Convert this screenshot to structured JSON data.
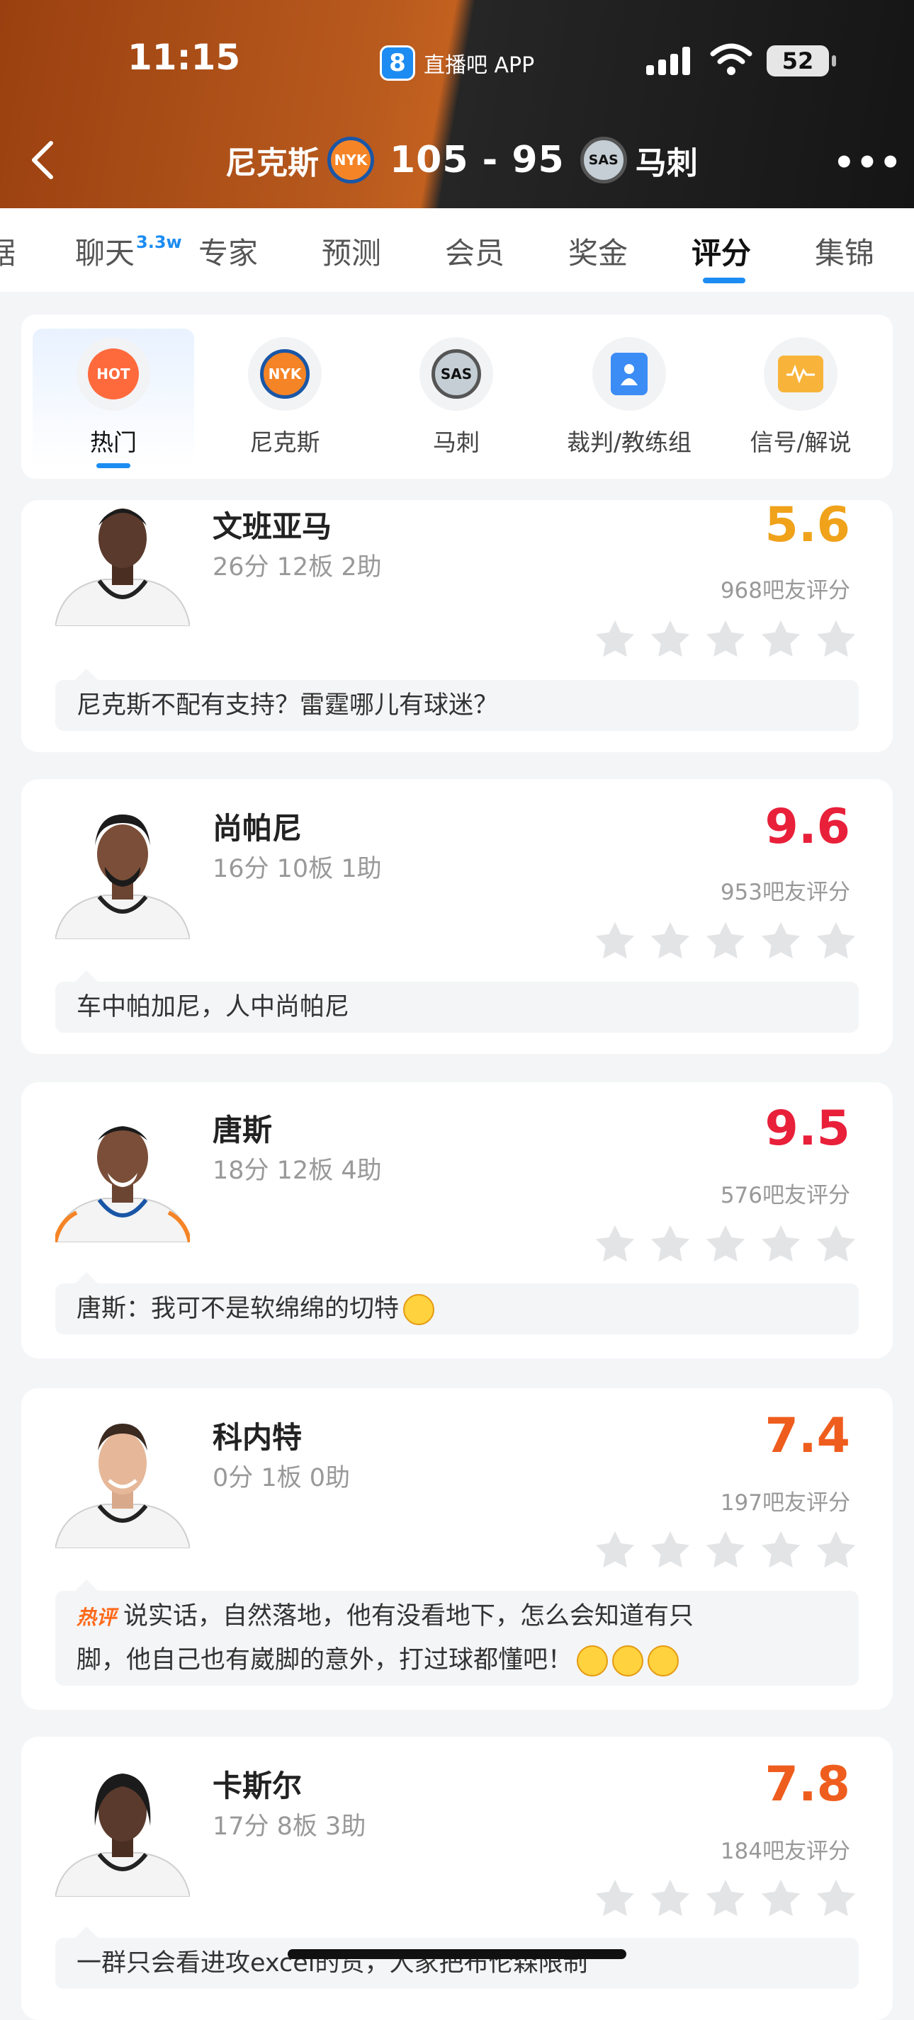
{
  "status_bar": {
    "time": "11:15",
    "app_name": "直播吧 APP",
    "battery": "52"
  },
  "header": {
    "home_team": "尼克斯",
    "home_logo": "NYK",
    "score": "105 - 95",
    "away_team": "马刺",
    "away_logo": "SAS"
  },
  "tabs": [
    {
      "label": "据"
    },
    {
      "label": "聊天",
      "badge": "3.3w"
    },
    {
      "label": "专家"
    },
    {
      "label": "预测"
    },
    {
      "label": "会员"
    },
    {
      "label": "奖金"
    },
    {
      "label": "评分",
      "active": true
    },
    {
      "label": "集锦"
    }
  ],
  "categories": [
    {
      "label": "热门",
      "icon": "hot-icon",
      "badge": "HOT"
    },
    {
      "label": "尼克斯",
      "icon": "knicks-logo-icon",
      "badge": "NYK"
    },
    {
      "label": "马刺",
      "icon": "spurs-logo-icon",
      "badge": "SAS"
    },
    {
      "label": "裁判/教练组",
      "icon": "referee-icon"
    },
    {
      "label": "信号/解说",
      "icon": "camera-signal-icon"
    }
  ],
  "players": [
    {
      "name": "文班亚马",
      "stats": "26分 12板 2助",
      "rating": "5.6",
      "rating_color": "#f0a21a",
      "votes": "968吧友评分",
      "comment": "尼克斯不配有支持？雷霆哪儿有球迷？",
      "jersey": "spurs"
    },
    {
      "name": "尚帕尼",
      "stats": "16分 10板 1助",
      "rating": "9.6",
      "rating_color": "#e8203a",
      "votes": "953吧友评分",
      "comment": "车中帕加尼，人中尚帕尼",
      "jersey": "spurs"
    },
    {
      "name": "唐斯",
      "stats": "18分 12板 4助",
      "rating": "9.5",
      "rating_color": "#e8203a",
      "votes": "576吧友评分",
      "comment": "唐斯：我可不是软绵绵的切特",
      "jersey": "knicks"
    },
    {
      "name": "科内特",
      "stats": "0分 1板 0助",
      "rating": "7.4",
      "rating_color": "#ef5d1e",
      "votes": "197吧友评分",
      "comment_tag": "热评",
      "comment_line1": "说实话，自然落地，他有没看地下，怎么会知道有只",
      "comment_line2": "脚，他自己也有崴脚的意外，打过球都懂吧！",
      "jersey": "spurs"
    },
    {
      "name": "卡斯尔",
      "stats": "17分 8板 3助",
      "rating": "7.8",
      "rating_color": "#ef5d1e",
      "votes": "184吧友评分",
      "comment": "一群只会看进攻excel的货，人家把布伦森限制",
      "jersey": "spurs"
    }
  ]
}
